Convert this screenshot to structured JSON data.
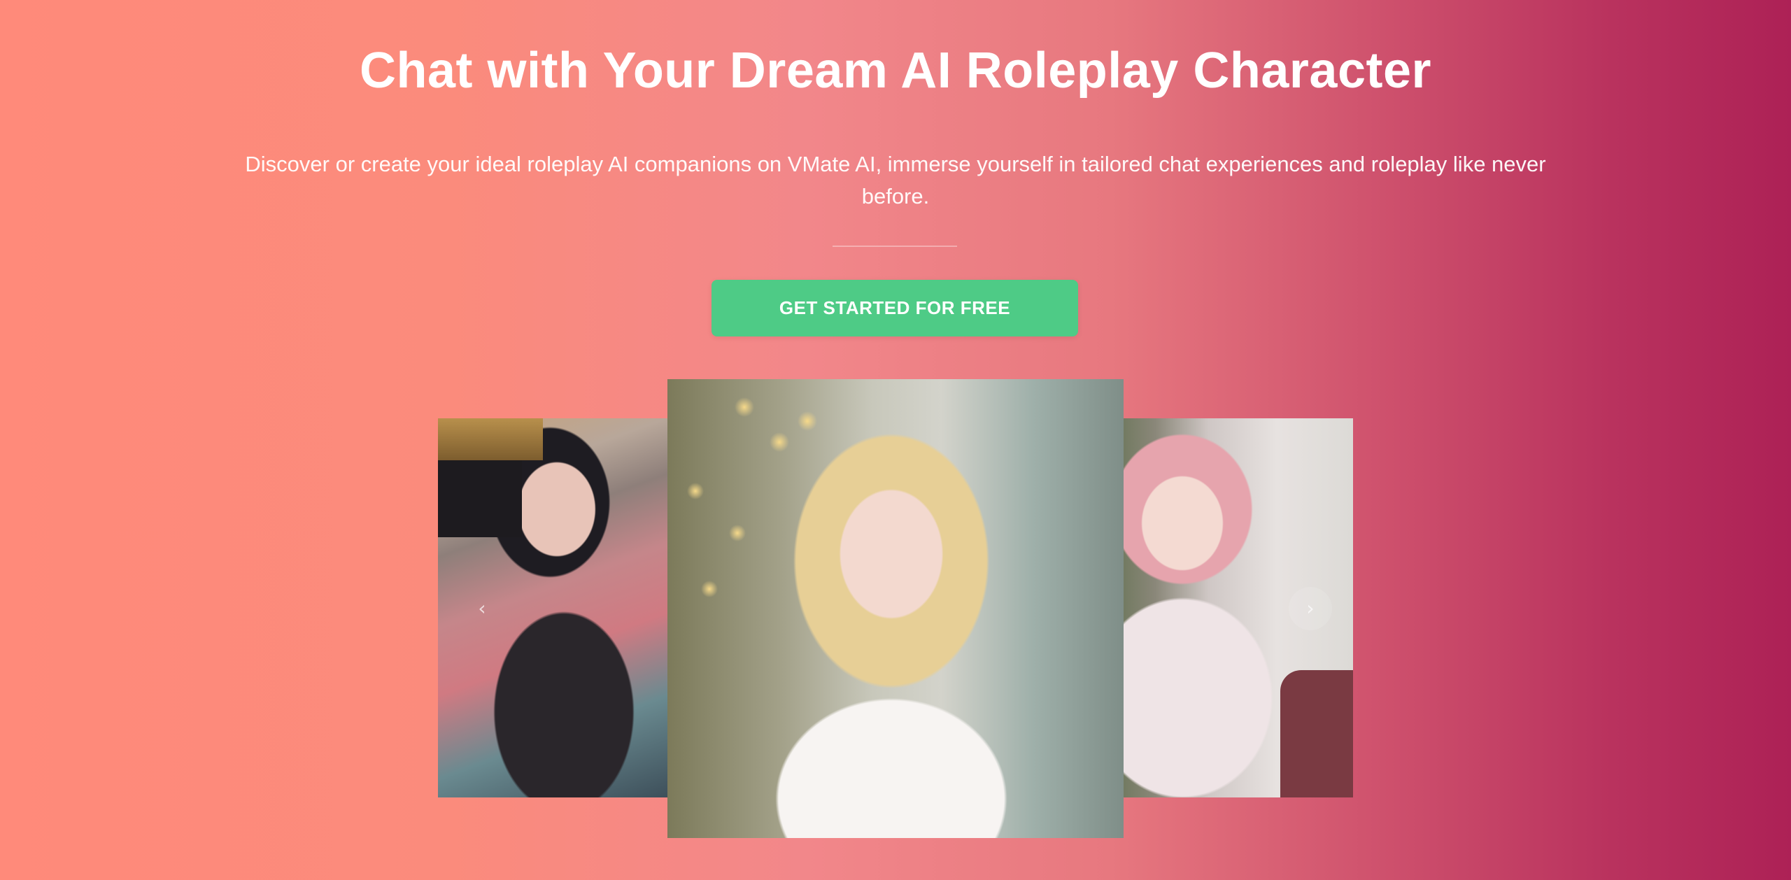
{
  "hero": {
    "title": "Chat with Your Dream AI Roleplay Character",
    "subtitle": "Discover or create your ideal roleplay AI companions on VMate AI, immerse yourself in tailored chat experiences and roleplay like never before.",
    "cta_label": "GET STARTED FOR FREE"
  },
  "carousel": {
    "prev_icon": "‹",
    "next_icon": "›",
    "slides": [
      {
        "name": "character-card-anime-dark-hair"
      },
      {
        "name": "character-card-blonde-woman"
      },
      {
        "name": "character-card-anime-pink-hair"
      }
    ]
  },
  "colors": {
    "cta": "#4ecb86",
    "gradient_start": "#ff8a7a",
    "gradient_end": "#ad2156"
  }
}
